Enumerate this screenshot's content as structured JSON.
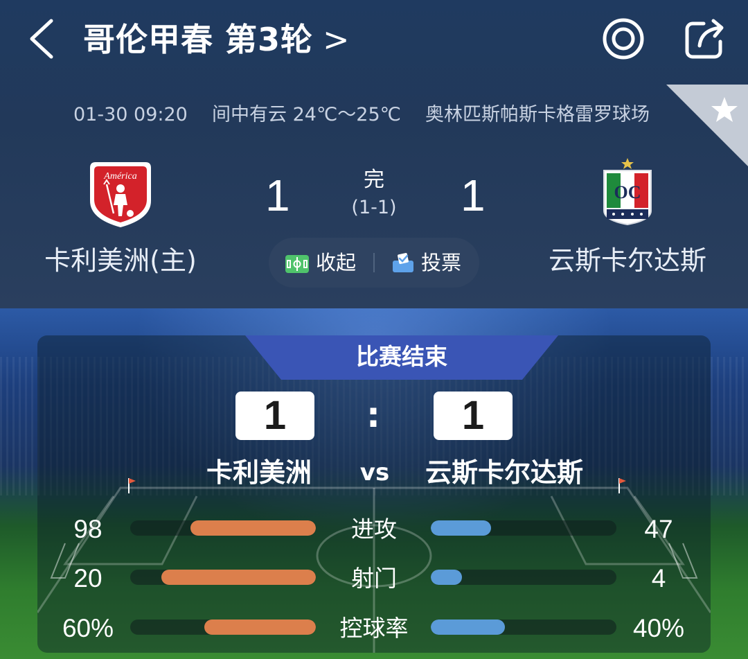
{
  "header": {
    "title": "哥伦甲春 第3轮",
    "title_chevron": ">",
    "date_time": "01-30 09:20",
    "weather": "间中有云 24℃～25℃",
    "venue": "奥林匹斯帕斯卡格雷罗球场"
  },
  "match": {
    "home_name": "卡利美洲(主)",
    "away_name": "云斯卡尔达斯",
    "home_logo_text": "América",
    "away_logo_text": "OC",
    "home_score": "1",
    "away_score": "1",
    "status": "完",
    "half_time": "(1-1)"
  },
  "actions": {
    "collapse_label": "收起",
    "vote_label": "投票"
  },
  "summary": {
    "ended_label": "比赛结束",
    "home_score": "1",
    "away_score": "1",
    "colon": ":",
    "home_name": "卡利美洲",
    "away_name": "云斯卡尔达斯",
    "vs": "vs",
    "stats": [
      {
        "label": "进攻",
        "home": "98",
        "away": "47",
        "home_value": 98,
        "away_value": 47
      },
      {
        "label": "射门",
        "home": "20",
        "away": "4",
        "home_value": 20,
        "away_value": 4
      },
      {
        "label": "控球率",
        "home": "60%",
        "away": "40%",
        "home_value": 60,
        "away_value": 40
      }
    ]
  },
  "colors": {
    "home_bar": "#dc7f4c",
    "away_bar": "#5b9bd8",
    "tab": "#3a55b5",
    "home_logo": "#d3222a",
    "away_logo_stripe_green": "#1f8a3c",
    "away_logo_stripe_red": "#d3222a"
  },
  "icons": {
    "back": "chevron-left-icon",
    "target": "target-icon",
    "share": "share-icon",
    "favorite": "star-icon",
    "collapse": "pitch-icon",
    "vote": "ballot-icon"
  }
}
